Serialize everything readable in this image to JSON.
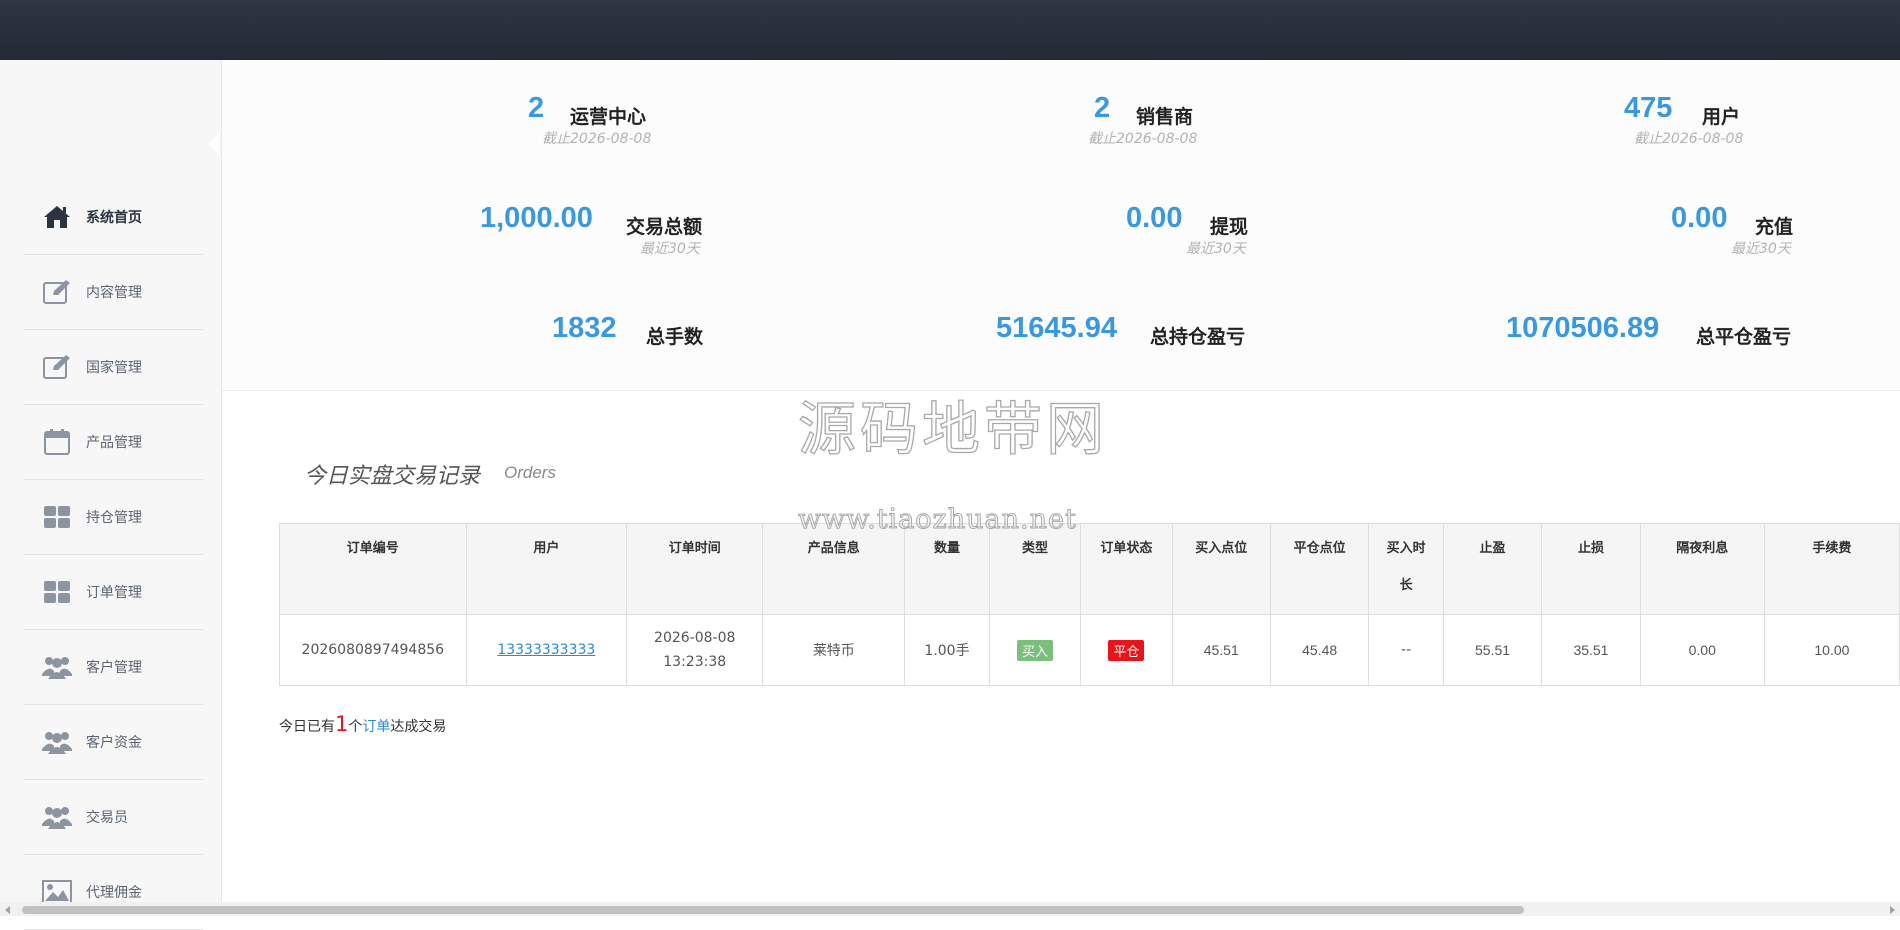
{
  "sidebar": {
    "items": [
      {
        "label": "系统首页",
        "icon": "home-icon"
      },
      {
        "label": "内容管理",
        "icon": "edit-icon"
      },
      {
        "label": "国家管理",
        "icon": "edit-icon"
      },
      {
        "label": "产品管理",
        "icon": "calendar-icon"
      },
      {
        "label": "持仓管理",
        "icon": "grid-icon"
      },
      {
        "label": "订单管理",
        "icon": "grid-icon"
      },
      {
        "label": "客户管理",
        "icon": "users-icon"
      },
      {
        "label": "客户资金",
        "icon": "users-icon"
      },
      {
        "label": "交易员",
        "icon": "users-icon"
      },
      {
        "label": "代理佣金",
        "icon": "image-icon"
      }
    ]
  },
  "stats": {
    "ops_center": {
      "value": "2",
      "label": "运营中心",
      "note": "截止2026-08-08"
    },
    "dealers": {
      "value": "2",
      "label": "销售商",
      "note": "截止2026-08-08"
    },
    "users": {
      "value": "475",
      "label": "用户",
      "note": "截止2026-08-08"
    },
    "volume": {
      "value": "1,000.00",
      "label": "交易总额",
      "note": "最近30天"
    },
    "withdraw": {
      "value": "0.00",
      "label": "提现",
      "note": "最近30天"
    },
    "deposit": {
      "value": "0.00",
      "label": "充值",
      "note": "最近30天"
    },
    "lots": {
      "value": "1832",
      "label": "总手数"
    },
    "open_pl": {
      "value": "51645.94",
      "label": "总持仓盈亏"
    },
    "closed_pl": {
      "value": "1070506.89",
      "label": "总平仓盈亏"
    }
  },
  "orders": {
    "title": "今日实盘交易记录",
    "subtitle": "Orders",
    "headers": {
      "id": "订单编号",
      "user": "用户",
      "time": "订单时间",
      "product": "产品信息",
      "qty": "数量",
      "type": "类型",
      "status": "订单状态",
      "buy_price": "买入点位",
      "close_price": "平仓点位",
      "hold_a": "买入时",
      "hold_b": "长",
      "tp": "止盈",
      "sl": "止损",
      "overnight": "隔夜利息",
      "fee": "手续费"
    },
    "rows": [
      {
        "id": "2026080897494856",
        "user": "13333333333",
        "date": "2026-08-08",
        "time": "13:23:38",
        "product": "莱特币",
        "qty": "1.00手",
        "type": "买入",
        "status": "平仓",
        "buy_price": "45.51",
        "close_price": "45.48",
        "hold": "--",
        "tp": "55.51",
        "sl": "35.51",
        "overnight": "0.00",
        "fee": "10.00"
      }
    ],
    "summary": {
      "prefix": "今日已有",
      "count": "1",
      "mid": "个",
      "link": "订单",
      "suffix": "达成交易"
    }
  },
  "watermark": {
    "cn": "源码地带网",
    "en": "www.tiaozhuan.net"
  },
  "colors": {
    "accent": "#3a98e0",
    "danger": "#e8141a",
    "buy": "#7cbf7c",
    "topbar": "#2b323d"
  }
}
